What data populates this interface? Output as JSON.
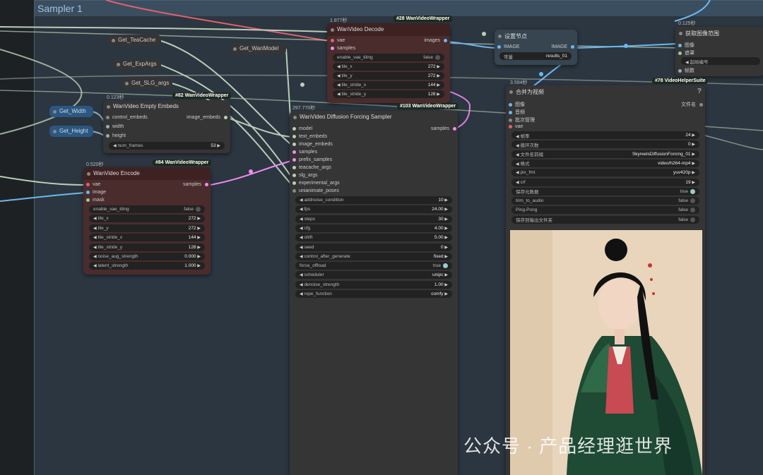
{
  "group": {
    "title": "Sampler 1"
  },
  "getters": {
    "teacache": "Get_TeaCache",
    "wanmodel": "Get_WanModel",
    "expargs": "Get_ExpArgs",
    "slgargs": "Get_SLG_args",
    "width": "Get_Width",
    "height": "Get_Height"
  },
  "decode": {
    "time": "1.877秒",
    "badge": "#28 WanVideoWrapper",
    "title": "WanVideo Decode",
    "inputs": [
      "vae",
      "samples"
    ],
    "output": "images",
    "widgets": [
      {
        "label": "enable_vae_tiling",
        "value": "false"
      },
      {
        "label": "tile_x",
        "value": "272"
      },
      {
        "label": "tile_y",
        "value": "272"
      },
      {
        "label": "tile_stride_x",
        "value": "144"
      },
      {
        "label": "tile_stride_y",
        "value": "128"
      }
    ]
  },
  "setnode": {
    "title": "设置节点",
    "in": "IMAGE",
    "out": "IMAGE",
    "const_label": "常量",
    "const_value": "results_01"
  },
  "range": {
    "time": "0.125秒",
    "title": "获取图像范围",
    "inputs": [
      "图像",
      "遮罩"
    ],
    "widget": "起始编号",
    "out": "帧数"
  },
  "embeds": {
    "time": "0.123秒",
    "badge": "#82 WanVideoWrapper",
    "title": "WanVideo Empty Embeds",
    "inputs": [
      "control_embeds",
      "width",
      "height"
    ],
    "output": "image_embeds",
    "widgets": [
      {
        "label": "num_frames",
        "value": "53"
      }
    ]
  },
  "sampler": {
    "time": "297.770秒",
    "badge": "#103 WanVideoWrapper",
    "title": "WanVideo Diffusion Forcing Sampler",
    "inputs": [
      "model",
      "text_embeds",
      "image_embeds",
      "samples",
      "prefix_samples",
      "teacache_args",
      "slg_args",
      "experimental_args",
      "unianimate_poses"
    ],
    "output": "samples",
    "widgets": [
      {
        "label": "addnoise_condition",
        "value": "10"
      },
      {
        "label": "fps",
        "value": "24.00"
      },
      {
        "label": "steps",
        "value": "30"
      },
      {
        "label": "cfg",
        "value": "4.00"
      },
      {
        "label": "shift",
        "value": "5.00"
      },
      {
        "label": "seed",
        "value": "0"
      },
      {
        "label": "control_after_generate",
        "value": "fixed"
      },
      {
        "label": "force_offload",
        "value": "true"
      },
      {
        "label": "scheduler",
        "value": "unipc"
      },
      {
        "label": "denoise_strength",
        "value": "1.00"
      },
      {
        "label": "rope_function",
        "value": "comfy"
      }
    ]
  },
  "encode": {
    "time": "0.520秒",
    "badge": "#84 WanVideoWrapper",
    "title": "WanVideo Encode",
    "inputs": [
      "vae",
      "image",
      "mask"
    ],
    "output": "samples",
    "widgets": [
      {
        "label": "enable_vae_tiling",
        "value": "false"
      },
      {
        "label": "tile_x",
        "value": "272"
      },
      {
        "label": "tile_y",
        "value": "272"
      },
      {
        "label": "tile_stride_x",
        "value": "144"
      },
      {
        "label": "tile_stride_y",
        "value": "128"
      },
      {
        "label": "noise_aug_strength",
        "value": "0.000"
      },
      {
        "label": "latent_strength",
        "value": "1.000"
      }
    ]
  },
  "combine": {
    "time": "3.594秒",
    "badge": "#78 VideoHelperSuite",
    "title": "合并为视频",
    "help": "?",
    "inputs": [
      "图像",
      "音频",
      "批次管理",
      "vae"
    ],
    "output": "文件名",
    "widgets": [
      {
        "label": "帧率",
        "value": "24"
      },
      {
        "label": "循环次数",
        "value": "0"
      },
      {
        "label": "文件名前缀",
        "value": "SkyreelsDiffusionForcing_01"
      },
      {
        "label": "格式",
        "value": "video/h264-mp4"
      },
      {
        "label": "pix_fmt",
        "value": "yuv420p"
      },
      {
        "label": "crf",
        "value": "19"
      },
      {
        "label": "保存元数据",
        "value": "true"
      },
      {
        "label": "trim_to_audio",
        "value": "false"
      },
      {
        "label": "Ping-Pong",
        "value": "false"
      },
      {
        "label": "保存到输出文件夹",
        "value": "false"
      }
    ]
  },
  "watermark": "公众号 · 产品经理逛世界"
}
